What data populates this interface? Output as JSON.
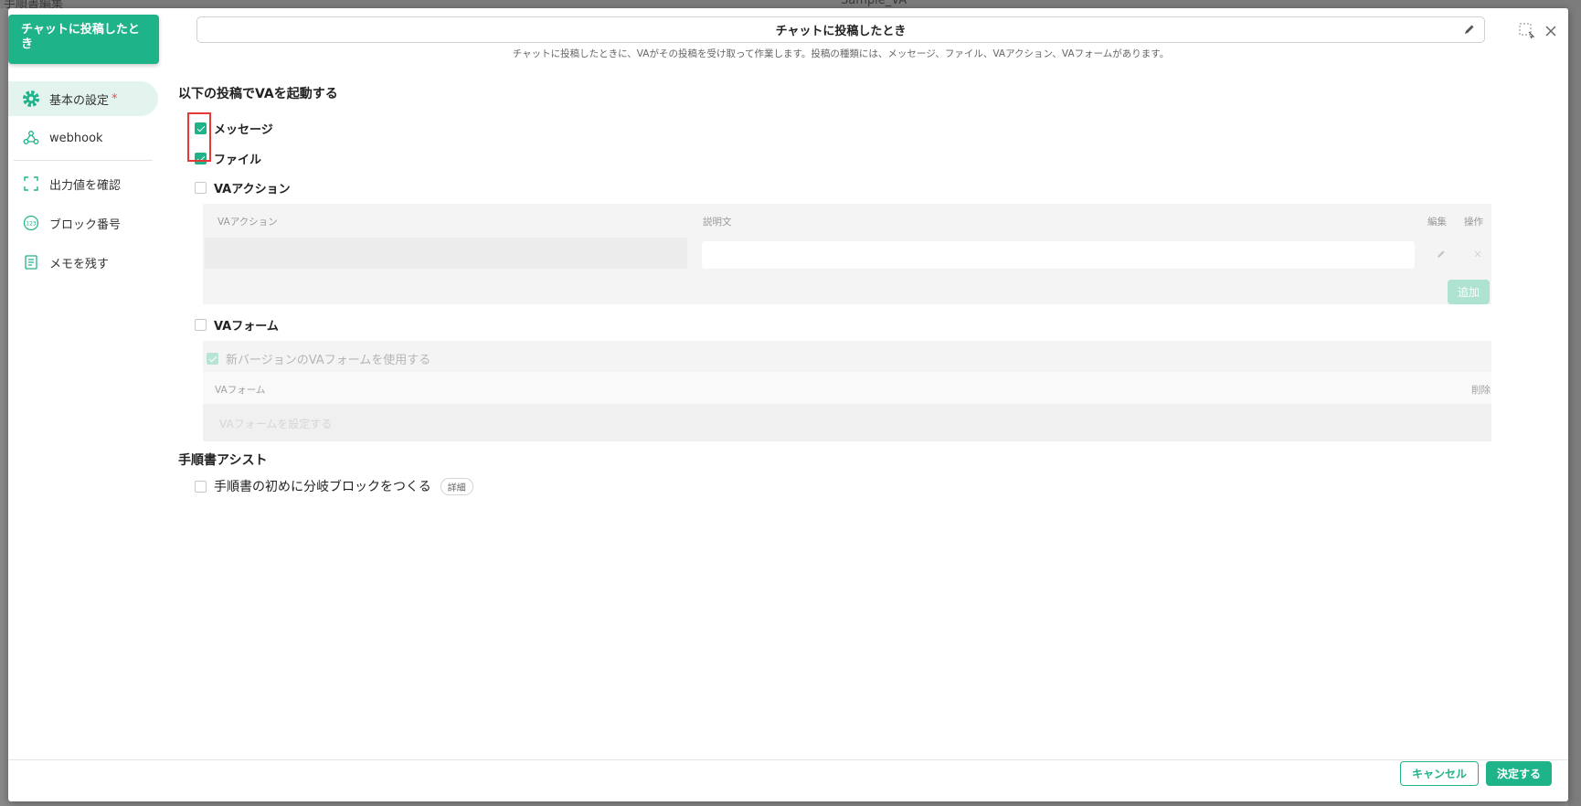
{
  "background": {
    "left_text": "手順書編集",
    "right_text": "Sample_VA"
  },
  "block": {
    "tag_label": "チャットに投稿したとき",
    "title_value": "チャットに投稿したとき",
    "description": "チャットに投稿したときに、VAがその投稿を受け取って作業します。投稿の種類には、メッセージ、ファイル、VAアクション、VAフォームがあります。"
  },
  "sidebar": {
    "items": [
      {
        "label": "基本の設定",
        "icon": "gear-icon",
        "required": "*"
      },
      {
        "label": "webhook",
        "icon": "webhook-icon"
      },
      {
        "label": "出力値を確認",
        "icon": "output-check-icon"
      },
      {
        "label": "ブロック番号",
        "icon": "block-number-icon"
      },
      {
        "label": "メモを残す",
        "icon": "memo-icon"
      }
    ]
  },
  "trigger": {
    "section_title": "以下の投稿でVAを起動する",
    "options": [
      {
        "label": "メッセージ",
        "checked": true
      },
      {
        "label": "ファイル",
        "checked": true
      },
      {
        "label": "VAアクション",
        "checked": false
      },
      {
        "label": "VAフォーム",
        "checked": false
      }
    ],
    "action_table": {
      "headers": [
        "VAアクション",
        "説明文",
        "編集",
        "操作"
      ],
      "add_label": "追加"
    },
    "form": {
      "new_version_label": "新バージョンのVAフォームを使用する",
      "headers": [
        "VAフォーム",
        "削除"
      ],
      "placeholder": "VAフォームを設定する"
    }
  },
  "assist": {
    "section_title": "手順書アシスト",
    "option_label": "手順書の初めに分岐ブロックをつくる",
    "detail_badge": "詳細"
  },
  "footer": {
    "cancel_label": "キャンセル",
    "ok_label": "決定する"
  },
  "colors": {
    "accent": "#1fb38a",
    "highlight_box": "#e53935"
  }
}
